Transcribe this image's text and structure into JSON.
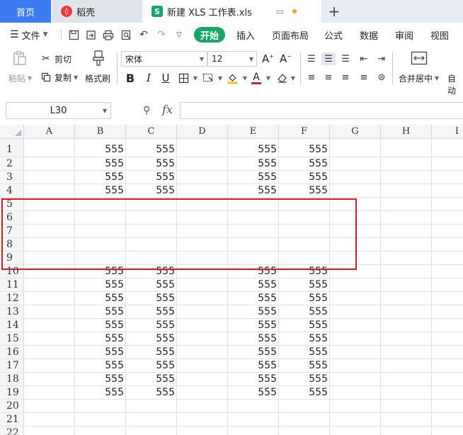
{
  "tabs": {
    "home": "首页",
    "daoke": "稻壳",
    "doc": "新建 XLS 工作表.xls",
    "add": "+"
  },
  "menu": {
    "file": "文件",
    "start": "开始",
    "items": [
      "插入",
      "页面布局",
      "公式",
      "数据",
      "审阅",
      "视图"
    ]
  },
  "ribbon": {
    "paste": "粘贴",
    "cut": "剪切",
    "copy": "复制",
    "format_painter": "格式刷",
    "font_name": "宋体",
    "font_size": "12",
    "merge_center": "合并居中",
    "auto_wrap": "自动"
  },
  "formula_bar": {
    "cell_ref": "L30",
    "fx": "fx",
    "formula": ""
  },
  "sheet": {
    "columns": [
      "A",
      "B",
      "C",
      "D",
      "E",
      "F",
      "G",
      "H",
      "I"
    ],
    "rows": [
      {
        "n": "1",
        "B": "555",
        "C": "555",
        "E": "555",
        "F": "555"
      },
      {
        "n": "2",
        "B": "555",
        "C": "555",
        "E": "555",
        "F": "555"
      },
      {
        "n": "3",
        "B": "555",
        "C": "555",
        "E": "555",
        "F": "555"
      },
      {
        "n": "4",
        "B": "555",
        "C": "555",
        "E": "555",
        "F": "555"
      },
      {
        "n": "5"
      },
      {
        "n": "6"
      },
      {
        "n": "7"
      },
      {
        "n": "8"
      },
      {
        "n": "9"
      },
      {
        "n": "10",
        "B": "555",
        "C": "555",
        "E": "555",
        "F": "555"
      },
      {
        "n": "11",
        "B": "555",
        "C": "555",
        "E": "555",
        "F": "555"
      },
      {
        "n": "12",
        "B": "555",
        "C": "555",
        "E": "555",
        "F": "555"
      },
      {
        "n": "13",
        "B": "555",
        "C": "555",
        "E": "555",
        "F": "555"
      },
      {
        "n": "14",
        "B": "555",
        "C": "555",
        "E": "555",
        "F": "555"
      },
      {
        "n": "15",
        "B": "555",
        "C": "555",
        "E": "555",
        "F": "555"
      },
      {
        "n": "16",
        "B": "555",
        "C": "555",
        "E": "555",
        "F": "555"
      },
      {
        "n": "17",
        "B": "555",
        "C": "555",
        "E": "555",
        "F": "555"
      },
      {
        "n": "18",
        "B": "555",
        "C": "555",
        "E": "555",
        "F": "555"
      },
      {
        "n": "19",
        "B": "555",
        "C": "555",
        "E": "555",
        "F": "555"
      },
      {
        "n": "20"
      },
      {
        "n": "21"
      },
      {
        "n": "22"
      }
    ]
  },
  "colors": {
    "accent_green": "#1aa469",
    "home_tab_blue": "#3d7bf0",
    "highlight_red": "#e5161c"
  }
}
